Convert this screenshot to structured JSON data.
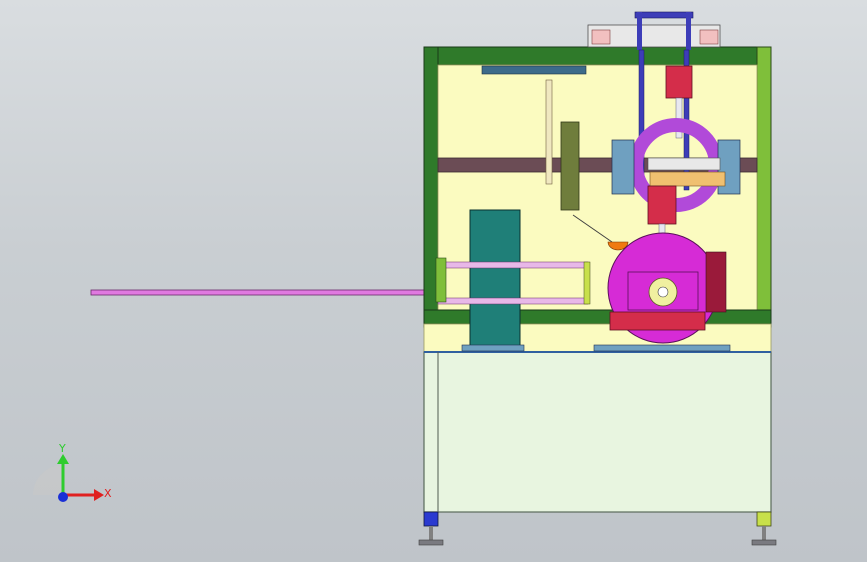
{
  "triad": {
    "y_label": "Y",
    "x_label": "X",
    "y_color": "#2ecc2e",
    "x_color": "#e02020",
    "z_color": "#1a2fd6"
  },
  "colors": {
    "frame": "#2f7a2a",
    "frame_light": "#7fbf3a",
    "panel": "#fbfbc0",
    "base": "#e8f5e0",
    "crossbar": "#6b4c55",
    "magenta": "#d62bd6",
    "ring": "#b14ad9",
    "teal_box": "#1f7f78",
    "blue_tube": "#3d3db8",
    "rod": "#e079e0",
    "red_block": "#d42d4a",
    "olive": "#6f7d3c",
    "orange": "#f07a10"
  }
}
